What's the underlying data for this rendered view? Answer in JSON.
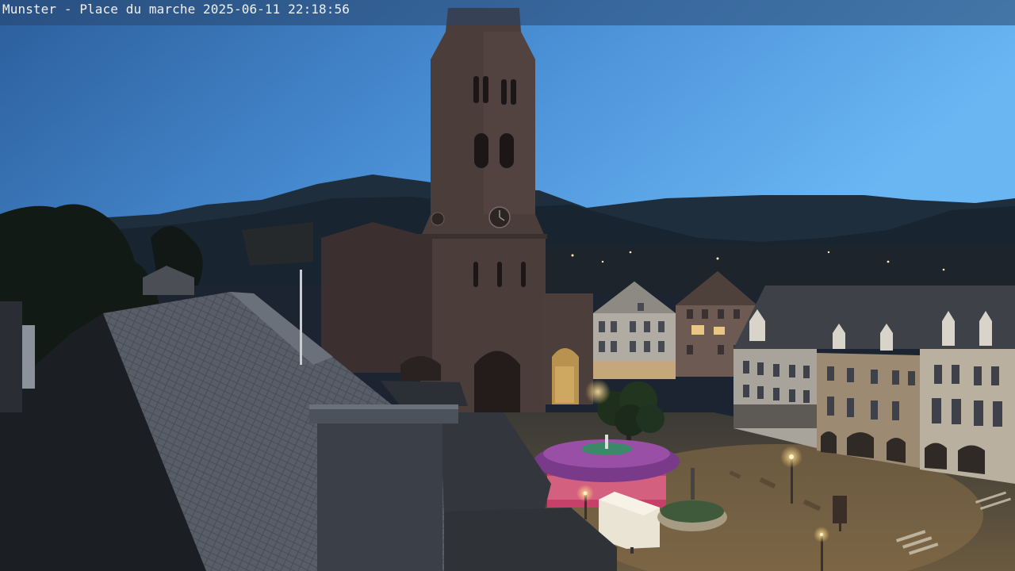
{
  "overlay": {
    "caption": "Munster - Place du marche 2025-06-11 22:18:56"
  },
  "scene": {
    "sky_top_color": "#2a5f9e",
    "sky_bottom_color": "#7dc3f6",
    "lamp_color": "#ffd27a",
    "carousel_roof_color": "#7a3a8a",
    "carousel_base_color": "#c6406a"
  }
}
